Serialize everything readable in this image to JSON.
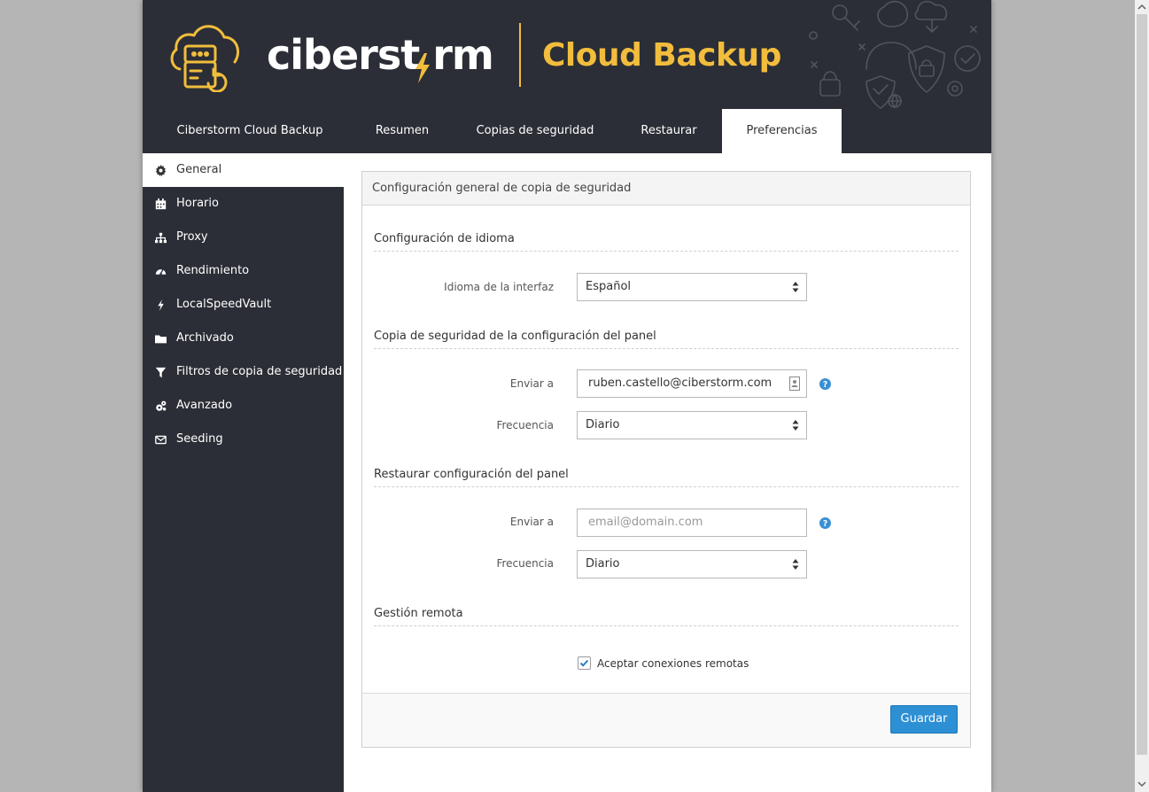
{
  "header": {
    "brand_text": "ciberst rm",
    "product_name": "Cloud Backup"
  },
  "tabs": [
    {
      "label": "Ciberstorm Cloud Backup"
    },
    {
      "label": "Resumen"
    },
    {
      "label": "Copias de seguridad"
    },
    {
      "label": "Restaurar"
    },
    {
      "label": "Preferencias",
      "active": true
    }
  ],
  "sidebar": {
    "items": [
      {
        "label": "General",
        "icon": "gear-icon",
        "active": true
      },
      {
        "label": "Horario",
        "icon": "calendar-icon"
      },
      {
        "label": "Proxy",
        "icon": "sitemap-icon"
      },
      {
        "label": "Rendimiento",
        "icon": "gauge-icon"
      },
      {
        "label": "LocalSpeedVault",
        "icon": "bolt-icon"
      },
      {
        "label": "Archivado",
        "icon": "folder-icon"
      },
      {
        "label": "Filtros de copia de seguridad",
        "icon": "filter-icon"
      },
      {
        "label": "Avanzado",
        "icon": "cogs-icon"
      },
      {
        "label": "Seeding",
        "icon": "envelope-icon"
      }
    ]
  },
  "panel": {
    "title": "Configuración general de copia de seguridad",
    "language_section": {
      "title": "Configuración de idioma",
      "label": "Idioma de la interfaz",
      "value": "Español"
    },
    "backup_config_section": {
      "title": "Copia de seguridad de la configuración del panel",
      "send_label": "Enviar a",
      "send_value": "ruben.castello@ciberstorm.com",
      "freq_label": "Frecuencia",
      "freq_value": "Diario"
    },
    "restore_config_section": {
      "title": "Restaurar configuración del panel",
      "send_label": "Enviar a",
      "send_placeholder": "email@domain.com",
      "freq_label": "Frecuencia",
      "freq_value": "Diario"
    },
    "remote_section": {
      "title": "Gestión remota",
      "checkbox_label": "Aceptar conexiones remotas",
      "checked": true
    },
    "save_label": "Guardar"
  },
  "colors": {
    "header_bg": "#2b2e36",
    "accent_yellow": "#f2bd3c",
    "button_blue": "#2d8fd4",
    "help_blue": "#3a8fd3"
  }
}
